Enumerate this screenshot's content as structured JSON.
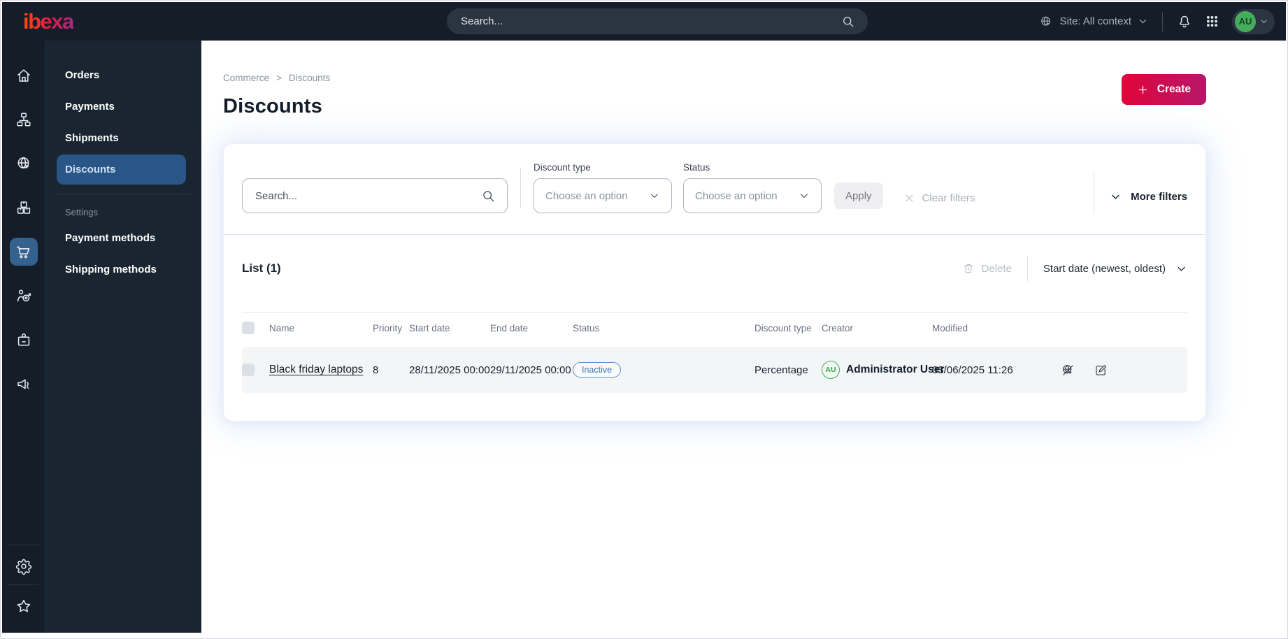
{
  "topbar": {
    "logo_text": "ibexa",
    "search_placeholder": "Search...",
    "site_selector_label": "Site: All context",
    "avatar_initials": "AU",
    "icons": [
      "site-globe-icon",
      "chevron-down-icon",
      "notifications-bell-icon",
      "app-grid-icon",
      "search-icon"
    ]
  },
  "sidebar": {
    "rail_icons": [
      "home-icon",
      "content-tree-icon",
      "site-globe-icon",
      "products-boxes-icon",
      "commerce-cart-icon",
      "customer-target-icon",
      "company-badge-icon",
      "marketing-megaphone-icon"
    ],
    "rail_active": "commerce-cart-icon",
    "bottom_icons": [
      "settings-gear-icon",
      "bookmarks-star-icon"
    ]
  },
  "menu": {
    "items": [
      "Orders",
      "Payments",
      "Shipments",
      "Discounts"
    ],
    "active_item": "Discounts",
    "settings_heading": "Settings",
    "settings_items": [
      "Payment methods",
      "Shipping methods"
    ]
  },
  "breadcrumb": {
    "items": [
      "Commerce",
      "Discounts"
    ],
    "separator": ">"
  },
  "page": {
    "title": "Discounts"
  },
  "actions": {
    "create_label": "Create"
  },
  "filters": {
    "search_placeholder": "Search...",
    "discount_type_label": "Discount type",
    "status_label": "Status",
    "choose_option_placeholder": "Choose an option",
    "apply_label": "Apply",
    "clear_filters_label": "Clear filters",
    "more_filters_label": "More filters"
  },
  "list": {
    "title": "List (1)",
    "delete_label": "Delete",
    "sort_label": "Start date (newest, oldest)",
    "columns": [
      "Name",
      "Priority",
      "Start date",
      "End date",
      "Status",
      "Discount type",
      "Creator",
      "Modified"
    ],
    "rows": [
      {
        "name": "Black friday laptops",
        "priority": "8",
        "start_date": "28/11/2025 00:00",
        "end_date": "29/11/2025 00:00",
        "status": "Inactive",
        "discount_type": "Percentage",
        "creator_initials": "AU",
        "creator_name": "Administrator User",
        "modified": "03/06/2025 11:26",
        "action_icons": [
          "preview-disabled-icon",
          "edit-icon"
        ]
      }
    ]
  },
  "colors": {
    "topbar_bg": "#141d28",
    "panel_bg": "#1a2532",
    "active_menu_blue": "#2a5687",
    "active_tile_blue": "#35618f",
    "brand_gradient_start": "#e00538",
    "brand_gradient_end": "#b6176b",
    "badge_blue": "#3f78b5",
    "avatar_green": "#47ab5c",
    "row_bg": "#f4f5f7"
  }
}
